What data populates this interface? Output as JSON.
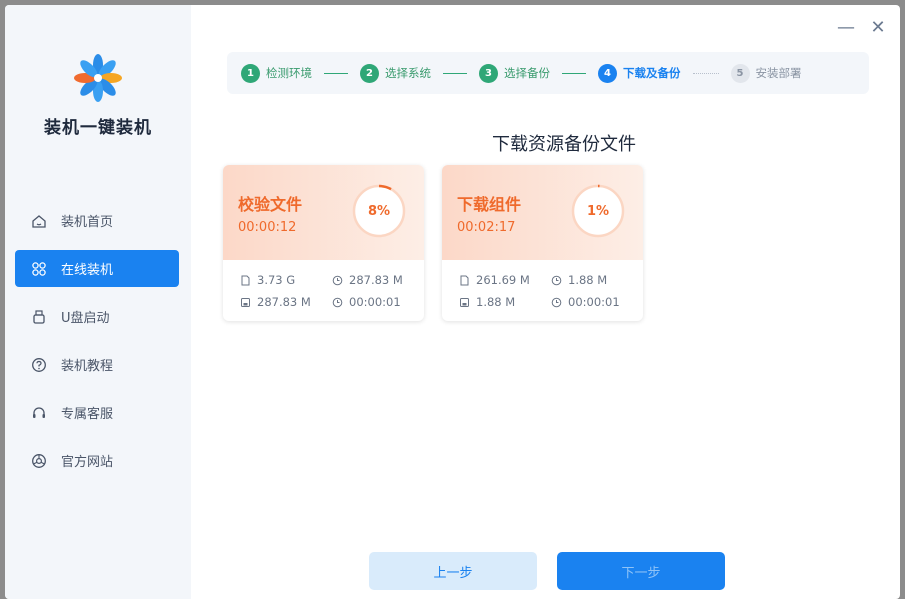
{
  "app": {
    "title": "装机一键装机",
    "minimize": "—",
    "close": "✕"
  },
  "sidebar": {
    "items": [
      {
        "label": "装机首页",
        "icon": "home-icon",
        "active": false
      },
      {
        "label": "在线装机",
        "icon": "apps-icon",
        "active": true
      },
      {
        "label": "U盘启动",
        "icon": "usb-icon",
        "active": false
      },
      {
        "label": "装机教程",
        "icon": "help-icon",
        "active": false
      },
      {
        "label": "专属客服",
        "icon": "headset-icon",
        "active": false
      },
      {
        "label": "官方网站",
        "icon": "globe-icon",
        "active": false
      }
    ]
  },
  "stepper": {
    "steps": [
      {
        "num": "1",
        "label": "检测环境",
        "state": "done"
      },
      {
        "num": "2",
        "label": "选择系统",
        "state": "done"
      },
      {
        "num": "3",
        "label": "选择备份",
        "state": "done"
      },
      {
        "num": "4",
        "label": "下载及备份",
        "state": "current"
      },
      {
        "num": "5",
        "label": "安装部署",
        "state": "pending"
      }
    ]
  },
  "main": {
    "title": "下载资源备份文件",
    "cards": [
      {
        "name": "校验文件",
        "time": "00:00:12",
        "progress_text": "8%",
        "progress": 0.08,
        "stats": [
          [
            "3.73 G",
            "287.83 M"
          ],
          [
            "287.83 M",
            "00:00:01"
          ]
        ]
      },
      {
        "name": "下载组件",
        "time": "00:02:17",
        "progress_text": "1%",
        "progress": 0.01,
        "stats": [
          [
            "261.69 M",
            "1.88 M"
          ],
          [
            "1.88 M",
            "00:00:01"
          ]
        ]
      }
    ]
  },
  "buttons": {
    "prev": "上一步",
    "next": "下一步"
  },
  "colors": {
    "accent": "#1a82f0",
    "success": "#2fa777",
    "warning": "#ef6a2c",
    "sidebar_bg": "#f3f6fa"
  }
}
